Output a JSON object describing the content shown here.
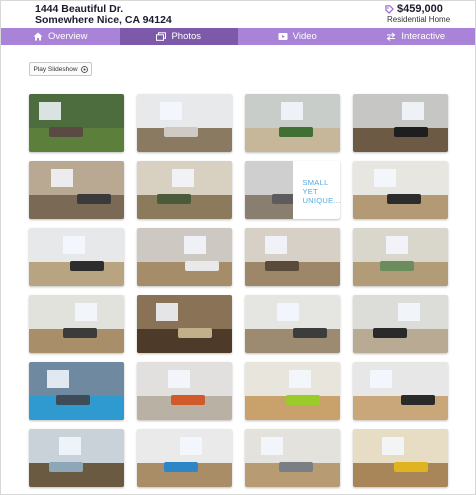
{
  "listing": {
    "address_line1": "1444 Beautiful Dr.",
    "address_line2": "Somewhere Nice, CA 94124",
    "price": "$459,000",
    "property_type": "Residential Home"
  },
  "colors": {
    "tab_bar": "#a883d8",
    "tab_active": "#7c5aa9",
    "tag_icon": "#9b6fd0",
    "overlay_text": "#5aa8e0"
  },
  "tabs": [
    {
      "label": "Overview",
      "icon": "home-icon",
      "active": false
    },
    {
      "label": "Photos",
      "icon": "photos-icon",
      "active": true
    },
    {
      "label": "Video",
      "icon": "video-icon",
      "active": false
    },
    {
      "label": "Interactive",
      "icon": "arrows-icon",
      "active": false
    }
  ],
  "slideshow": {
    "label": "Play Slideshow",
    "icon": "play-icon"
  },
  "overlay": {
    "line1": "SMALL",
    "line2": "YET",
    "line3": "UNIQUE..."
  },
  "photos": [
    {
      "subject": "house exterior with trees",
      "bg": "#4e6d3f",
      "floor": "#5c7f3c",
      "accent": "#5b4a43"
    },
    {
      "subject": "white staircase",
      "bg": "#e7e9ea",
      "floor": "#8a7a62",
      "accent": "#cfcac4"
    },
    {
      "subject": "living room with plant",
      "bg": "#c9cdca",
      "floor": "#c7b79a",
      "accent": "#3f6f32"
    },
    {
      "subject": "dining room",
      "bg": "#c6c6c4",
      "floor": "#6d5a45",
      "accent": "#1e1e1e"
    },
    {
      "subject": "living room with fireplace",
      "bg": "#b9a892",
      "floor": "#7a6a55",
      "accent": "#3a3a3a"
    },
    {
      "subject": "living room with bookshelves",
      "bg": "#d8d0c0",
      "floor": "#8c7a5c",
      "accent": "#4a5a3a"
    },
    {
      "subject": "stairs with text overlay",
      "bg": "#cfcfcf",
      "floor": "#8a7e70",
      "accent": "#5c5c5c"
    },
    {
      "subject": "bright living room",
      "bg": "#e8e6e0",
      "floor": "#b49a74",
      "accent": "#2c2c2c"
    },
    {
      "subject": "living room with sofas",
      "bg": "#e6e8ea",
      "floor": "#b9a481",
      "accent": "#2d2d2d"
    },
    {
      "subject": "dining room with chairs",
      "bg": "#cdc8c2",
      "floor": "#a58d6a",
      "accent": "#e9e9e9"
    },
    {
      "subject": "living room with vase",
      "bg": "#d6d0c6",
      "floor": "#9e8768",
      "accent": "#5a4a3a"
    },
    {
      "subject": "sitting room",
      "bg": "#d9d6cc",
      "floor": "#b29c77",
      "accent": "#6b8c5c"
    },
    {
      "subject": "kitchen with island",
      "bg": "#e2e2dc",
      "floor": "#a88f6a",
      "accent": "#3b3b3b"
    },
    {
      "subject": "bar kitchen",
      "bg": "#8a7256",
      "floor": "#4e3a28",
      "accent": "#c2b08a"
    },
    {
      "subject": "living room with windows",
      "bg": "#e5e5e1",
      "floor": "#9c8b70",
      "accent": "#3c3c3c"
    },
    {
      "subject": "living room with chandelier",
      "bg": "#dcdcd8",
      "floor": "#b9ab93",
      "accent": "#2a2a2a"
    },
    {
      "subject": "indoor pool",
      "bg": "#6f8aa0",
      "floor": "#2f9ad0",
      "accent": "#3d4c57"
    },
    {
      "subject": "modern room with art",
      "bg": "#e1e0de",
      "floor": "#b8b1a4",
      "accent": "#d05a2a"
    },
    {
      "subject": "lime wall room",
      "bg": "#e8e6dc",
      "floor": "#c9a26b",
      "accent": "#9acb2a"
    },
    {
      "subject": "modern kitchen",
      "bg": "#e7e7e7",
      "floor": "#c9a77a",
      "accent": "#2a2a2a"
    },
    {
      "subject": "glass block room",
      "bg": "#c9d2d8",
      "floor": "#6b5a42",
      "accent": "#8ea7b8"
    },
    {
      "subject": "blue wall room",
      "bg": "#eaeaea",
      "floor": "#a98d66",
      "accent": "#2e86c7"
    },
    {
      "subject": "bright hall",
      "bg": "#e4e2dc",
      "floor": "#b79c73",
      "accent": "#7a7f85"
    },
    {
      "subject": "yellow kitchen",
      "bg": "#e7dcc4",
      "floor": "#a9865a",
      "accent": "#e0b420"
    }
  ]
}
